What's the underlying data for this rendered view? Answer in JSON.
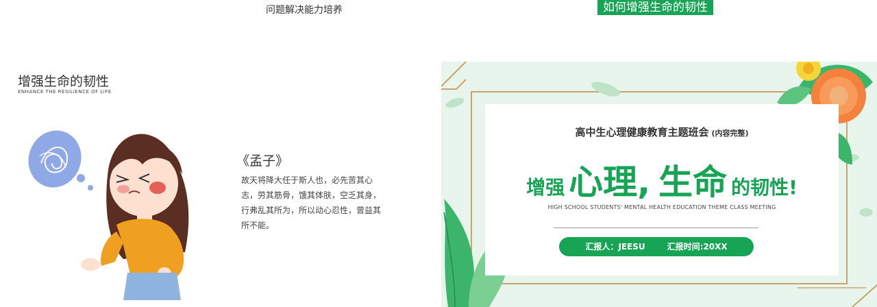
{
  "top": {
    "left_label": "问题解决能力培养",
    "right_tag": "如何增强生命的韧性"
  },
  "slide_left": {
    "title": "增强生命的韧性",
    "subtitle": "ENHANCE THE RESILIENCE OF LIFE",
    "quote_title": "《孟子》",
    "quote_body": "故天将降大任于斯人也，必先苦其心志，劳其筋骨，饿其体肤，空乏其身，行弗乱其所为，所以动心忍性，曾益其所不能。"
  },
  "slide_right": {
    "card_title": "高中生心理健康教育主题班会",
    "card_title_suffix": "(内容完整)",
    "headline_a": "增强",
    "headline_b": "心理,",
    "headline_c": "生命",
    "headline_d": "的韧性!",
    "english_subtitle": "HIGH SCHOOL STUDENTS' MENTAL HEALTH EDUCATION THEME CLASS MEETING",
    "reporter": "汇报人：JEESU",
    "report_time": "汇报时间:20XX"
  },
  "colors": {
    "accent_green": "#17a455",
    "frame_gold": "#c8a46a",
    "sweater_orange": "#f0a020",
    "skirt_blue": "#8fb4e0",
    "flower_orange": "#f4823c",
    "leaf_green": "#3bb56a"
  }
}
